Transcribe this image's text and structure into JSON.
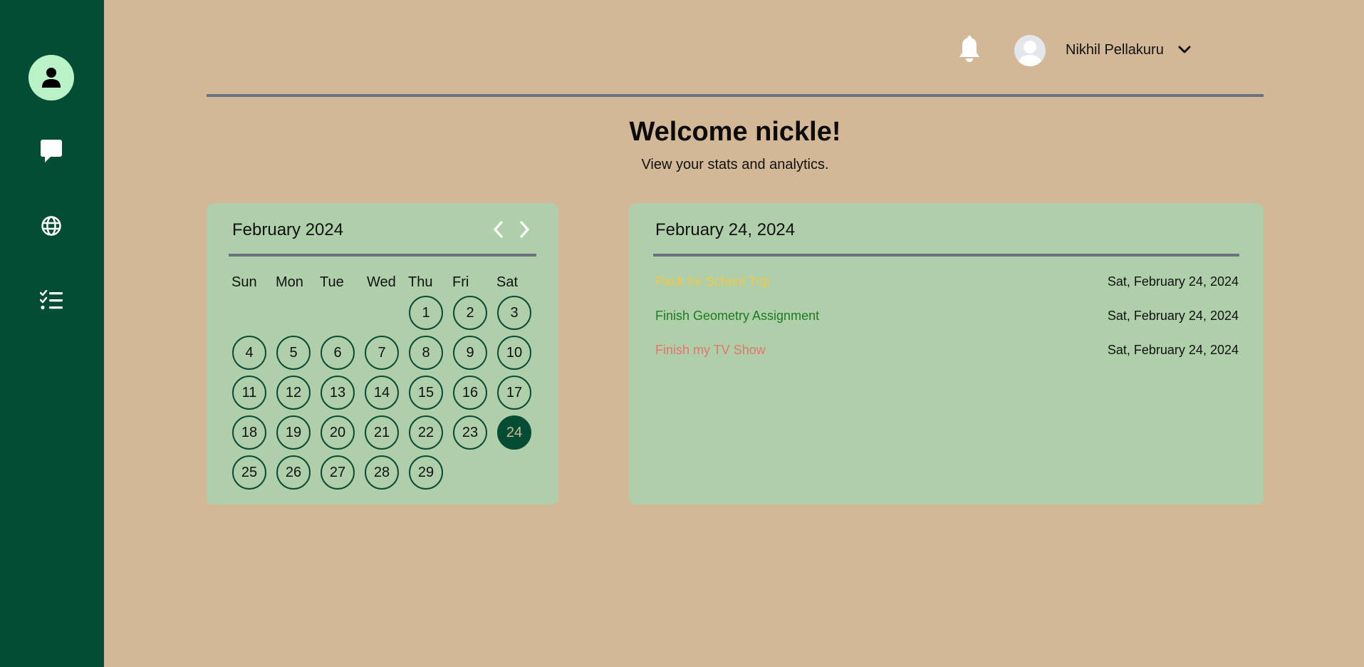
{
  "sidebar": {
    "items": [
      {
        "icon": "user-icon",
        "active": true
      },
      {
        "icon": "chat-icon",
        "active": false
      },
      {
        "icon": "globe-icon",
        "active": false
      },
      {
        "icon": "task-list-icon",
        "active": false
      }
    ]
  },
  "topbar": {
    "user_name": "Nikhil Pellakuru"
  },
  "welcome": {
    "title": "Welcome nickle!",
    "subtitle": "View your stats and analytics."
  },
  "calendar": {
    "month_label": "February 2024",
    "weekdays": [
      "Sun",
      "Mon",
      "Tue",
      "Wed",
      "Thu",
      "Fri",
      "Sat"
    ],
    "first_weekday_index": 4,
    "days_in_month": 29,
    "selected_day": 24
  },
  "tasks": {
    "date_heading": "February 24, 2024",
    "items": [
      {
        "name": "Pack for School Trip",
        "date": "Sat, February 24, 2024",
        "color": "#f2c84b"
      },
      {
        "name": "Finish Geometry Assignment",
        "date": "Sat, February 24, 2024",
        "color": "#1f7a1f"
      },
      {
        "name": "Finish my TV Show",
        "date": "Sat, February 24, 2024",
        "color": "#e8736e"
      }
    ]
  },
  "colors": {
    "background": "#d2b896",
    "sidebar": "#034d34",
    "card": "#aecfaa",
    "accent": "#b9f2c6"
  }
}
